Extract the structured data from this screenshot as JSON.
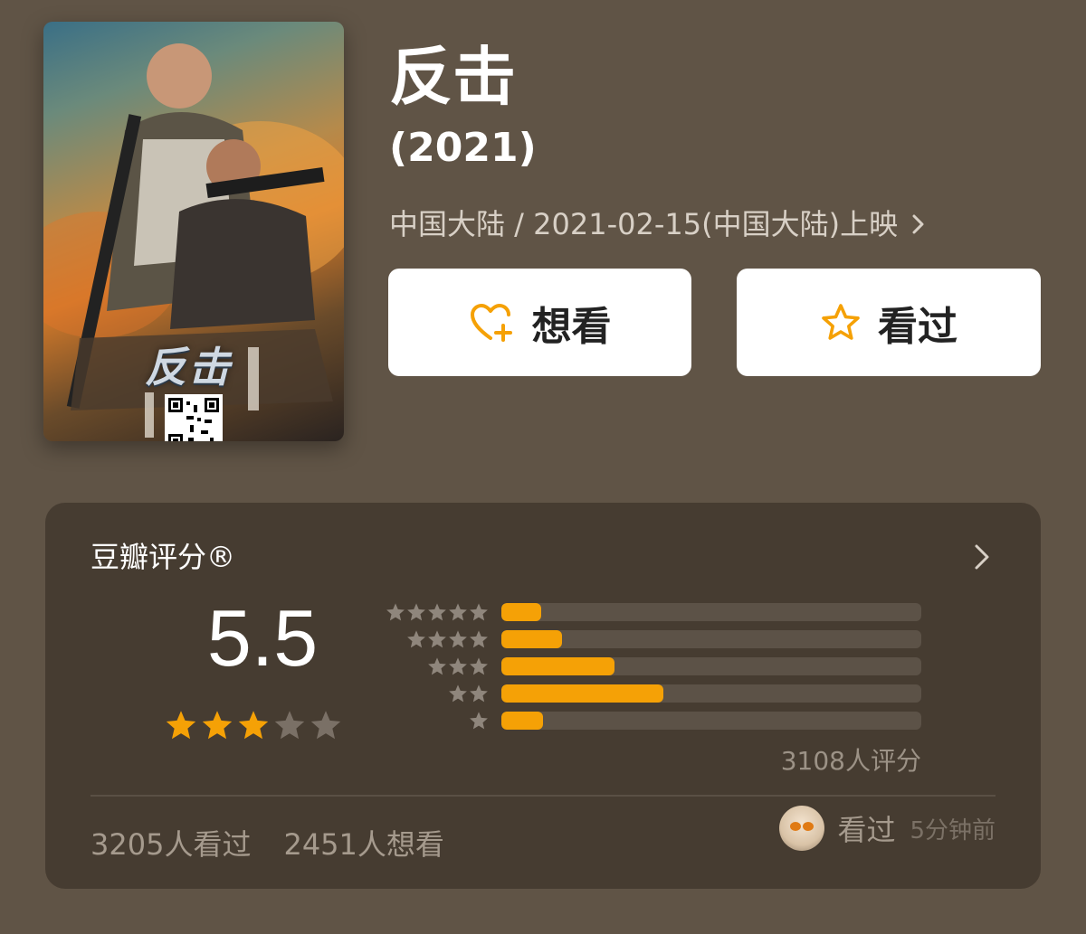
{
  "movie": {
    "title": "反击",
    "year": "(2021)",
    "release_info": "中国大陆 / 2021-02-15(中国大陆)上映",
    "poster": {
      "title_text": "反击"
    }
  },
  "actions": {
    "want_label": "想看",
    "seen_label": "看过"
  },
  "rating": {
    "header": "豆瓣评分®",
    "score": "5.5",
    "score_stars": 3,
    "distribution": [
      {
        "stars": 5,
        "fraction": 0.095
      },
      {
        "stars": 4,
        "fraction": 0.145
      },
      {
        "stars": 3,
        "fraction": 0.27
      },
      {
        "stars": 2,
        "fraction": 0.385
      },
      {
        "stars": 1,
        "fraction": 0.1
      }
    ],
    "count_text": "3108人评分"
  },
  "stats": {
    "seen_text": "3205人看过",
    "want_text": "2451人想看"
  },
  "activity": {
    "label": "看过",
    "time": "5分钟前"
  },
  "colors": {
    "background": "#605446",
    "card": "#463c31",
    "accent": "#f5a106"
  }
}
